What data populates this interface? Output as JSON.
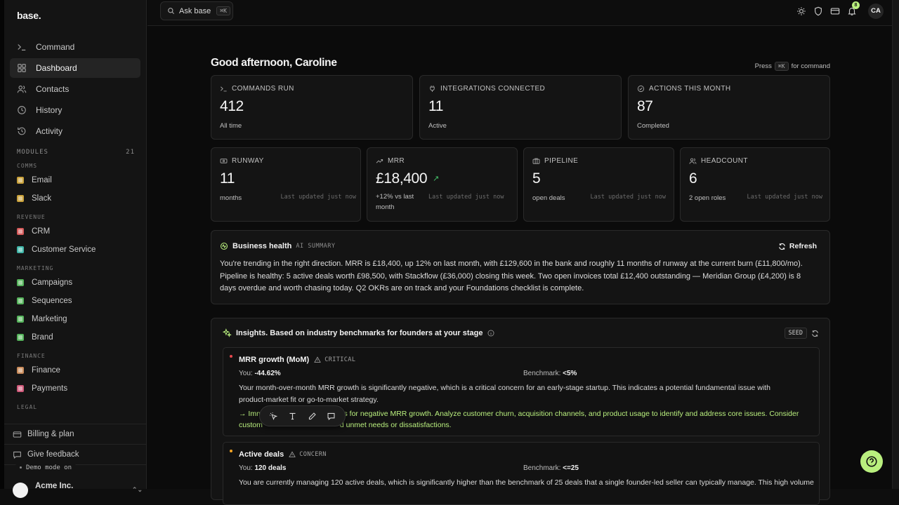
{
  "sidebar": {
    "logo": "base.",
    "nav": [
      {
        "label": "Command",
        "icon": "terminal-icon"
      },
      {
        "label": "Dashboard",
        "icon": "grid-icon",
        "active": true
      },
      {
        "label": "Contacts",
        "icon": "users-icon"
      },
      {
        "label": "History",
        "icon": "clock-icon"
      },
      {
        "label": "Activity",
        "icon": "history-icon"
      }
    ],
    "modules_label": "MODULES",
    "modules_count": "21",
    "groups": [
      {
        "title": "COMMS",
        "items": [
          {
            "label": "Email",
            "color": "#c9a13a"
          },
          {
            "label": "Slack",
            "color": "#c9a13a"
          }
        ]
      },
      {
        "title": "REVENUE",
        "items": [
          {
            "label": "CRM",
            "color": "#d65a5a"
          },
          {
            "label": "Customer Service",
            "color": "#3fb6a8"
          }
        ]
      },
      {
        "title": "MARKETING",
        "items": [
          {
            "label": "Campaigns",
            "color": "#56b45c"
          },
          {
            "label": "Sequences",
            "color": "#56b45c"
          },
          {
            "label": "Marketing",
            "color": "#56b45c"
          },
          {
            "label": "Brand",
            "color": "#56b45c"
          }
        ]
      },
      {
        "title": "FINANCE",
        "items": [
          {
            "label": "Finance",
            "color": "#c98b5a"
          },
          {
            "label": "Payments",
            "color": "#d05a7a"
          }
        ]
      },
      {
        "title": "LEGAL",
        "items": []
      }
    ],
    "billing": "Billing & plan",
    "feedback": "Give feedback",
    "demo": "Demo mode on",
    "workspace": "Acme Inc."
  },
  "topbar": {
    "search_label": "Ask base",
    "search_kbd": "⌘K",
    "notif_count": "8",
    "avatar": "CA"
  },
  "main": {
    "greeting": "Good afternoon, Caroline",
    "press_pre": "Press",
    "press_kbd": "⌘K",
    "press_post": "for command",
    "stats_top": [
      {
        "label": "COMMANDS RUN",
        "value": "412",
        "sub": "All time"
      },
      {
        "label": "INTEGRATIONS CONNECTED",
        "value": "11",
        "sub": "Active"
      },
      {
        "label": "ACTIONS THIS MONTH",
        "value": "87",
        "sub": "Completed"
      }
    ],
    "stats_bottom": [
      {
        "label": "RUNWAY",
        "value": "11",
        "sub": "months",
        "updated": "Last updated just now"
      },
      {
        "label": "MRR",
        "value": "£18,400",
        "arrow": "↗",
        "sub": "+12% vs last month",
        "updated": "Last updated just now"
      },
      {
        "label": "PIPELINE",
        "value": "5",
        "sub": "open deals",
        "updated": "Last updated just now"
      },
      {
        "label": "HEADCOUNT",
        "value": "6",
        "sub": "2 open roles",
        "updated": "Last updated just now"
      }
    ],
    "health": {
      "title": "Business health",
      "tag": "AI SUMMARY",
      "refresh": "Refresh",
      "text": "You're trending in the right direction. MRR is £18,400, up 12% on last month, with £129,600 in the bank and roughly 11 months of runway at the current burn (£11,800/mo). Pipeline is healthy: 5 active deals worth £98,500, with Stackflow (£36,000) closing this week. Two open invoices total £12,400 outstanding — Meridian Group (£4,200) is 8 days overdue and worth chasing today. Q2 OKRs are on track and your Foundations checklist is complete."
    },
    "insights": {
      "title": "Insights. Based on industry benchmarks for founders at your stage",
      "stage": "SEED",
      "items": [
        {
          "title": "MRR growth (MoM)",
          "severity": "CRITICAL",
          "severity_color": "#e5484d",
          "you_label": "You:",
          "you": "-44.62%",
          "bench_label": "Benchmark:",
          "bench": "<5%",
          "text": "Your month-over-month MRR growth is significantly negative, which is a critical concern for an early-stage startup. This indicates a potential fundamental issue with product-market fit or go-to-market strategy.",
          "rec_a": "→ Imm",
          "rec_b": "ons for negative MRR growth. Analyze customer churn, acquisition channels, and product usage to identify and address core issues. Consider",
          "rec_c": "custom",
          "rec_d": "d unmet needs or dissatisfactions."
        },
        {
          "title": "Active deals",
          "severity": "CONCERN",
          "severity_color": "#f5a524",
          "you_label": "You:",
          "you": "120 deals",
          "bench_label": "Benchmark:",
          "bench": "<=25",
          "text": "You are currently managing 120 active deals, which is significantly higher than the benchmark of 25 deals that a single founder-led seller can typically manage. This high volume of"
        }
      ]
    }
  },
  "colors": {
    "accent": "#b9ef7e",
    "positive": "#45c26a",
    "critical": "#e5484d",
    "concern": "#f5a524"
  }
}
